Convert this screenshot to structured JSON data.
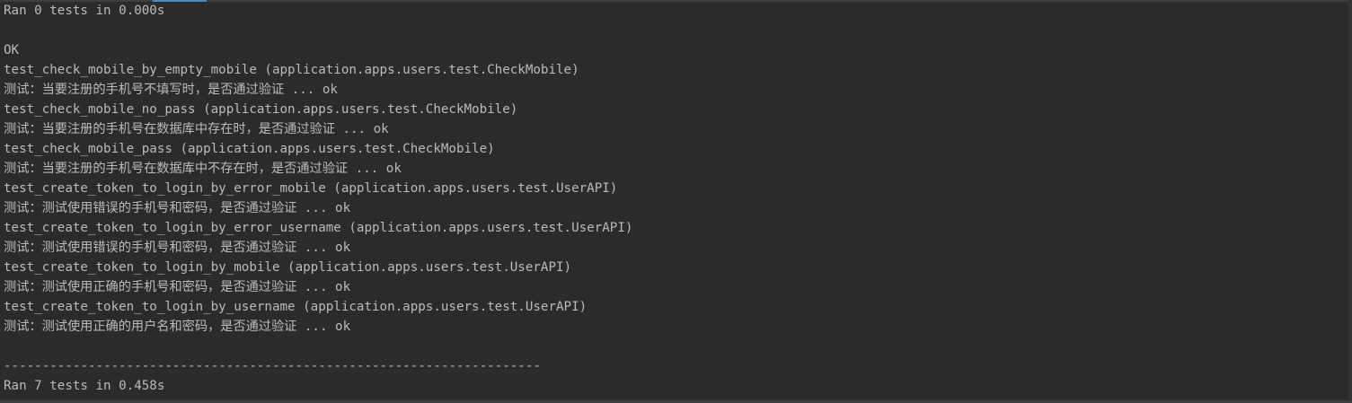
{
  "console": {
    "lines": [
      "Ran 0 tests in 0.000s",
      "",
      "OK",
      "test_check_mobile_by_empty_mobile (application.apps.users.test.CheckMobile)",
      "测试：当要注册的手机号不填写时，是否通过验证 ... ok",
      "test_check_mobile_no_pass (application.apps.users.test.CheckMobile)",
      "测试：当要注册的手机号在数据库中存在时，是否通过验证 ... ok",
      "test_check_mobile_pass (application.apps.users.test.CheckMobile)",
      "测试：当要注册的手机号在数据库中不存在时，是否通过验证 ... ok",
      "test_create_token_to_login_by_error_mobile (application.apps.users.test.UserAPI)",
      "测试：测试使用错误的手机号和密码，是否通过验证 ... ok",
      "test_create_token_to_login_by_error_username (application.apps.users.test.UserAPI)",
      "测试：测试使用错误的手机号和密码，是否通过验证 ... ok",
      "test_create_token_to_login_by_mobile (application.apps.users.test.UserAPI)",
      "测试：测试使用正确的手机号和密码，是否通过验证 ... ok",
      "test_create_token_to_login_by_username (application.apps.users.test.UserAPI)",
      "测试：测试使用正确的用户名和密码，是否通过验证 ... ok",
      "",
      "----------------------------------------------------------------------",
      "Ran 7 tests in 0.458s"
    ]
  },
  "colors": {
    "background": "#2b2b2b",
    "text": "#bbbbbb",
    "accent": "#4a88c7"
  }
}
